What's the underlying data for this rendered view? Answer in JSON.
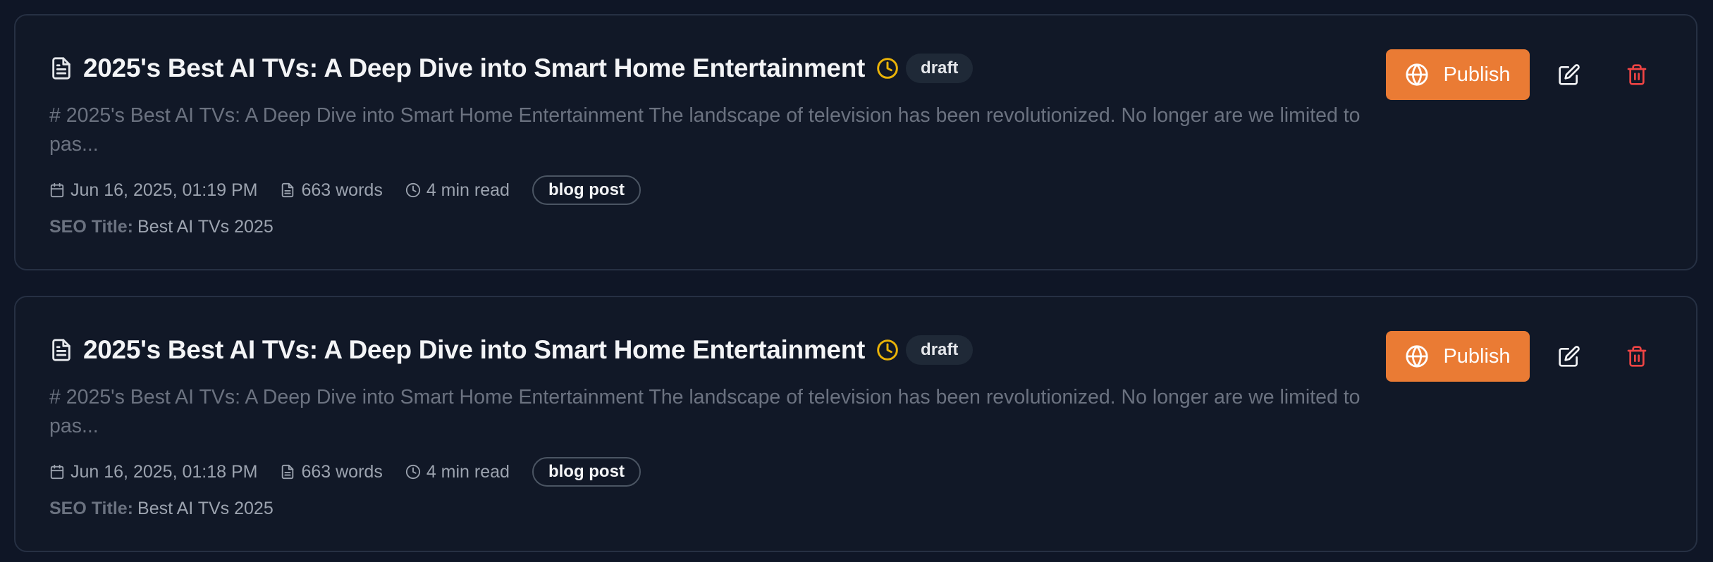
{
  "colors": {
    "background": "#0f1626",
    "card": "#111827",
    "accent": "#ea7b34",
    "draft_clock": "#eab308",
    "delete": "#ef4444"
  },
  "posts": [
    {
      "title": "2025's Best AI TVs: A Deep Dive into Smart Home Entertainment",
      "status": "draft",
      "status_icon": "clock-icon",
      "excerpt": "# 2025's Best AI TVs: A Deep Dive into Smart Home Entertainment The landscape of television has been revolutionized. No longer are we limited to pas...",
      "date": "Jun 16, 2025, 01:19 PM",
      "words": "663 words",
      "read_time": "4 min read",
      "type": "blog post",
      "seo_label": "SEO Title:",
      "seo_title": "Best AI TVs 2025",
      "publish_label": "Publish"
    },
    {
      "title": "2025's Best AI TVs: A Deep Dive into Smart Home Entertainment",
      "status": "draft",
      "status_icon": "clock-icon",
      "excerpt": "# 2025's Best AI TVs: A Deep Dive into Smart Home Entertainment The landscape of television has been revolutionized. No longer are we limited to pas...",
      "date": "Jun 16, 2025, 01:18 PM",
      "words": "663 words",
      "read_time": "4 min read",
      "type": "blog post",
      "seo_label": "SEO Title:",
      "seo_title": "Best AI TVs 2025",
      "publish_label": "Publish"
    }
  ]
}
